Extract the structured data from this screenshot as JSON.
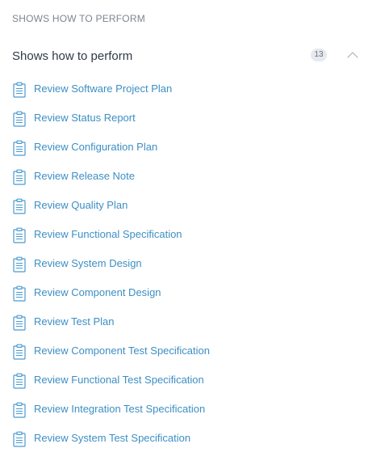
{
  "section": {
    "heading": "SHOWS HOW TO PERFORM"
  },
  "group": {
    "title": "Shows how to perform",
    "count": "13"
  },
  "items": [
    {
      "label": "Review Software Project Plan"
    },
    {
      "label": "Review Status Report"
    },
    {
      "label": "Review Configuration Plan"
    },
    {
      "label": "Review Release Note"
    },
    {
      "label": "Review Quality Plan"
    },
    {
      "label": "Review Functional Specification"
    },
    {
      "label": "Review System Design"
    },
    {
      "label": "Review Component Design"
    },
    {
      "label": "Review Test Plan"
    },
    {
      "label": "Review Component Test Specification"
    },
    {
      "label": "Review Functional Test Specification"
    },
    {
      "label": "Review Integration Test Specification"
    },
    {
      "label": "Review System Test Specification"
    }
  ],
  "icons": {
    "item_icon": "clipboard-icon",
    "toggle_icon": "chevron-up-icon"
  },
  "colors": {
    "link": "#3d8fc4",
    "icon": "#4a9ad0",
    "heading": "#7d8590",
    "title": "#2f3a45",
    "badge_bg": "#e6e9ee"
  }
}
